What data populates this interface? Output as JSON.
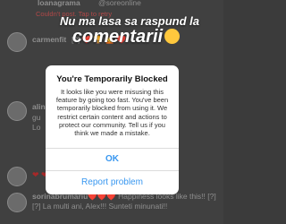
{
  "top_row": {
    "username_partial": "loanagrama",
    "mention": "@soreonline",
    "retry_text": "Couldn't post. Tap to retry"
  },
  "overlay": {
    "line1": "Nu ma lasa sa raspund la",
    "line2": "comentarii"
  },
  "comments": [
    {
      "username": "carmenfit",
      "text": "[?] ❤️ 🏆 🙋 ❤️"
    },
    {
      "username": "alin",
      "text": "gu Lo"
    },
    {
      "username": "",
      "text": "❤ ❤ ❤"
    },
    {
      "username": "sorinabrumariu",
      "text": "❤️❤️❤️ Happiness looks like this!! [?][?] La multi ani, Alex!!! Sunteti minunati!!"
    }
  ],
  "dialog": {
    "title": "You're Temporarily Blocked",
    "body": "It looks like you were misusing this feature by going too fast. You've been temporarily blocked from using it. We restrict certain content and actions to protect our community. Tell us if you think we made a mistake.",
    "ok_label": "OK",
    "report_label": "Report problem"
  },
  "colors": {
    "link_blue": "#3897f0",
    "heart_red": "#d0302f"
  }
}
